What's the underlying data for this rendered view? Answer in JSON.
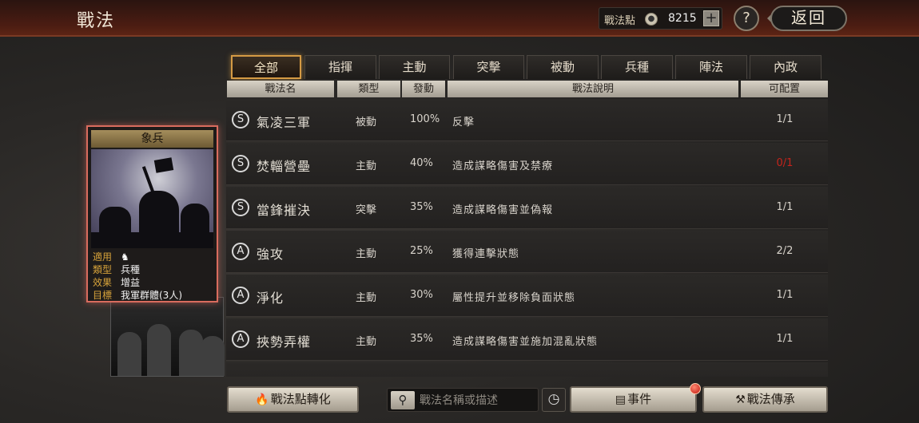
{
  "header": {
    "title": "戰法",
    "points_label": "戰法點",
    "points_value": "8215",
    "plus_label": "+",
    "help_label": "?",
    "back_label": "返回"
  },
  "card": {
    "title": "象兵",
    "info": [
      {
        "key": "適用",
        "value": ""
      },
      {
        "key": "類型",
        "value": "兵種"
      },
      {
        "key": "效果",
        "value": "增益"
      },
      {
        "key": "目標",
        "value": "我軍群體(3人)"
      }
    ]
  },
  "tabs": [
    {
      "label": "全部",
      "active": true
    },
    {
      "label": "指揮",
      "active": false
    },
    {
      "label": "主動",
      "active": false
    },
    {
      "label": "突擊",
      "active": false
    },
    {
      "label": "被動",
      "active": false
    },
    {
      "label": "兵種",
      "active": false
    },
    {
      "label": "陣法",
      "active": false
    },
    {
      "label": "內政",
      "active": false
    }
  ],
  "columns": [
    "戰法名",
    "類型",
    "發動",
    "戰法說明",
    "可配置"
  ],
  "rows": [
    {
      "grade": "S",
      "name": "氣凌三軍",
      "type": "被動",
      "rate": "100%",
      "desc": "反擊",
      "slots": "1/1",
      "slots_color": "#d8d3cb"
    },
    {
      "grade": "S",
      "name": "焚輜營壘",
      "type": "主動",
      "rate": "40%",
      "desc": "造成謀略傷害及禁療",
      "slots": "0/1",
      "slots_color": "#c4241c"
    },
    {
      "grade": "S",
      "name": "當鋒摧決",
      "type": "突擊",
      "rate": "35%",
      "desc": "造成謀略傷害並偽報",
      "slots": "1/1",
      "slots_color": "#d8d3cb"
    },
    {
      "grade": "A",
      "name": "強攻",
      "type": "主動",
      "rate": "25%",
      "desc": "獲得連擊狀態",
      "slots": "2/2",
      "slots_color": "#d8d3cb"
    },
    {
      "grade": "A",
      "name": "淨化",
      "type": "主動",
      "rate": "30%",
      "desc": "屬性提升並移除負面狀態",
      "slots": "1/1",
      "slots_color": "#d8d3cb"
    },
    {
      "grade": "A",
      "name": "挾勢弄權",
      "type": "主動",
      "rate": "35%",
      "desc": "造成謀略傷害並施加混亂狀態",
      "slots": "1/1",
      "slots_color": "#d8d3cb"
    }
  ],
  "bottom": {
    "convert_label": "戰法點轉化",
    "search_placeholder": "戰法名稱或描述",
    "events_label": "事件",
    "inherit_label": "戰法傳承"
  },
  "icons": {
    "coin": "coin-icon",
    "search": "magnifier-icon",
    "clock": "clock-icon",
    "events": "scroll-icon",
    "inherit": "hammer-icon",
    "convert": "fire-icon",
    "card_apply": "horse-icon"
  }
}
